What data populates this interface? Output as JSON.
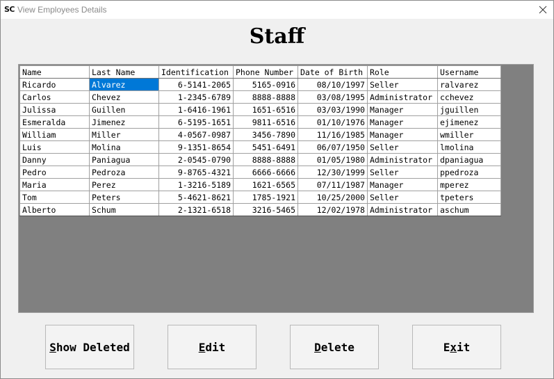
{
  "window": {
    "app_icon": "SC",
    "title": "View Employees Details",
    "close_icon": "close-icon"
  },
  "page_title": "Staff",
  "table": {
    "columns": [
      "Name",
      "Last Name",
      "Identification",
      "Phone Number",
      "Date of Birth",
      "Role",
      "Username"
    ],
    "selected_row": 0,
    "selected_col": 1,
    "rows": [
      [
        "Ricardo",
        "Alvarez",
        "6-5141-2065",
        "5165-0916",
        "08/10/1997",
        "Seller",
        "ralvarez"
      ],
      [
        "Carlos",
        "Chevez",
        "1-2345-6789",
        "8888-8888",
        "03/08/1995",
        "Administrator",
        "cchevez"
      ],
      [
        "Julissa",
        "Guillen",
        "1-6416-1961",
        "1651-6516",
        "03/03/1990",
        "Manager",
        "jguillen"
      ],
      [
        "Esmeralda",
        "Jimenez",
        "6-5195-1651",
        "9811-6516",
        "01/10/1976",
        "Manager",
        "ejimenez"
      ],
      [
        "William",
        "Miller",
        "4-0567-0987",
        "3456-7890",
        "11/16/1985",
        "Manager",
        "wmiller"
      ],
      [
        "Luis",
        "Molina",
        "9-1351-8654",
        "5451-6491",
        "06/07/1950",
        "Seller",
        "lmolina"
      ],
      [
        "Danny",
        "Paniagua",
        "2-0545-0790",
        "8888-8888",
        "01/05/1980",
        "Administrator",
        "dpaniagua"
      ],
      [
        "Pedro",
        "Pedroza",
        "9-8765-4321",
        "6666-6666",
        "12/30/1999",
        "Seller",
        "ppedroza"
      ],
      [
        "Maria",
        "Perez",
        "1-3216-5189",
        "1621-6565",
        "07/11/1987",
        "Manager",
        "mperez"
      ],
      [
        "Tom",
        "Peters",
        "5-4621-8621",
        "1785-1921",
        "10/25/2000",
        "Seller",
        "tpeters"
      ],
      [
        "Alberto",
        "Schum",
        "2-1321-6518",
        "3216-5465",
        "12/02/1978",
        "Administrator",
        "aschum"
      ]
    ]
  },
  "buttons": {
    "show_deleted": {
      "first": "S",
      "rest": "how Deleted"
    },
    "edit": {
      "first": "E",
      "rest": "dit"
    },
    "delete": {
      "first": "D",
      "rest": "elete"
    },
    "exit": {
      "pre": "E",
      "under": "x",
      "post": "it"
    }
  },
  "colors": {
    "selection": "#0078d7",
    "grid_background": "#808080",
    "window_background": "#f0f0f0"
  }
}
